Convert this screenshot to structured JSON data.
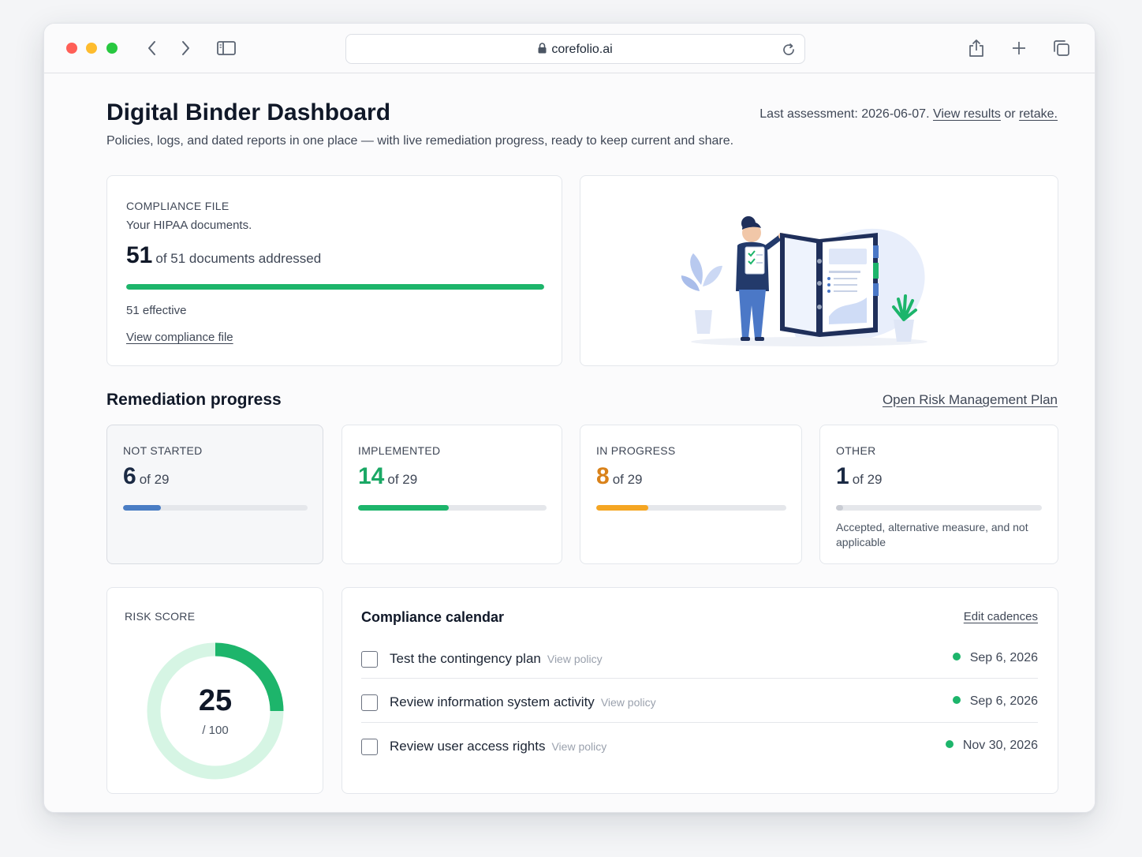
{
  "browser": {
    "url": "corefolio.ai",
    "lights": {
      "red": "#ff5f57",
      "yellow": "#febc2e",
      "green": "#28c840"
    }
  },
  "header": {
    "title": "Digital Binder Dashboard",
    "subtitle": "Policies, logs, and dated reports in one place — with live remediation progress, ready to keep current and share.",
    "assessment_prefix": "Last assessment: 2026-06-07.",
    "view_results": "View results",
    "or": "or",
    "retake": "retake."
  },
  "compliance_file": {
    "label": "COMPLIANCE FILE",
    "sub": "Your HIPAA documents.",
    "count": "51",
    "count_text": "of 51 documents addressed",
    "progress": 1.0,
    "effective": "51 effective",
    "link": "View compliance file"
  },
  "remediation": {
    "title": "Remediation progress",
    "plan_link": "Open Risk Management Plan",
    "cards": [
      {
        "label": "NOT STARTED",
        "value": "6",
        "of": "of 29",
        "fraction": 0.2069,
        "color": "#4a7dc4",
        "num_color": "#1b2a44"
      },
      {
        "label": "IMPLEMENTED",
        "value": "14",
        "of": "of 29",
        "fraction": 0.4828,
        "color": "#1db56b",
        "num_color": "#1aa865"
      },
      {
        "label": "IN PROGRESS",
        "value": "8",
        "of": "of 29",
        "fraction": 0.2759,
        "color": "#f5a623",
        "num_color": "#d9821a"
      },
      {
        "label": "OTHER",
        "value": "1",
        "of": "of 29",
        "fraction": 0.0345,
        "color": "#c9ccd3",
        "num_color": "#1b2a44",
        "note": "Accepted, alternative measure, and not applicable"
      }
    ]
  },
  "risk": {
    "label": "RISK SCORE",
    "score": "25",
    "out_of": "/ 100",
    "fraction": 0.25,
    "ring_color": "#1db56b",
    "track_color": "#d6f5e4"
  },
  "calendar": {
    "title": "Compliance calendar",
    "edit": "Edit cadences",
    "items": [
      {
        "task": "Test the contingency plan",
        "view": "View policy",
        "date": "Sep 6, 2026"
      },
      {
        "task": "Review information system activity",
        "view": "View policy",
        "date": "Sep 6, 2026"
      },
      {
        "task": "Review user access rights",
        "view": "View policy",
        "date": "Nov 30, 2026"
      }
    ]
  }
}
